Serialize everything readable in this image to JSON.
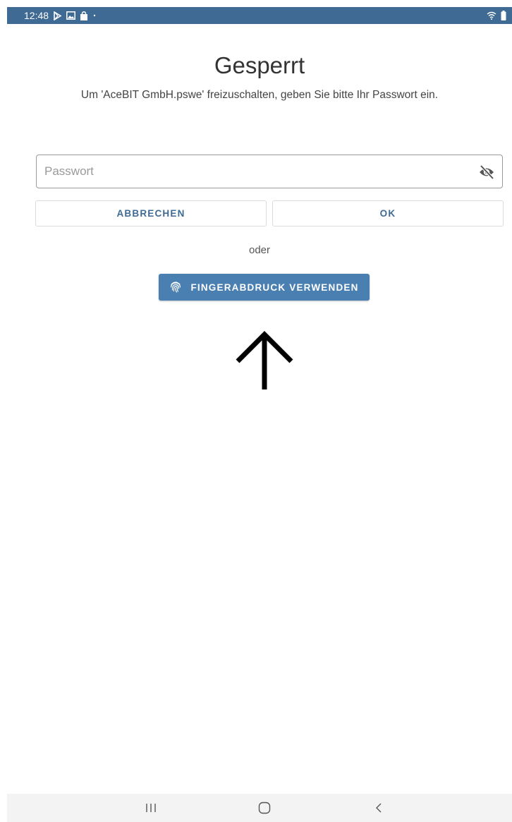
{
  "status_bar": {
    "time": "12:48",
    "left_icons": [
      "play-store-notification-icon",
      "gallery-notification-icon",
      "shopping-bag-notification-icon",
      "more-dot-icon"
    ],
    "right_icons": [
      "wifi-icon",
      "battery-icon"
    ]
  },
  "lock_screen": {
    "title": "Gesperrt",
    "subtitle": "Um 'AceBIT GmbH.pswe' freizuschalten, geben Sie bitte Ihr Passwort ein.",
    "password_placeholder": "Passwort",
    "password_value": "",
    "visibility_icon": "eye-off-icon",
    "cancel_label": "ABBRECHEN",
    "ok_label": "OK",
    "or_text": "oder",
    "fingerprint_label": "FINGERABDRUCK VERWENDEN",
    "fingerprint_icon": "fingerprint-icon"
  },
  "nav_bar": {
    "icons": [
      "recents-icon",
      "home-icon",
      "back-icon"
    ]
  },
  "colors": {
    "accent": "#4a7fb2",
    "status_bar": "#3f6a93",
    "button_text": "#3f6a93"
  }
}
